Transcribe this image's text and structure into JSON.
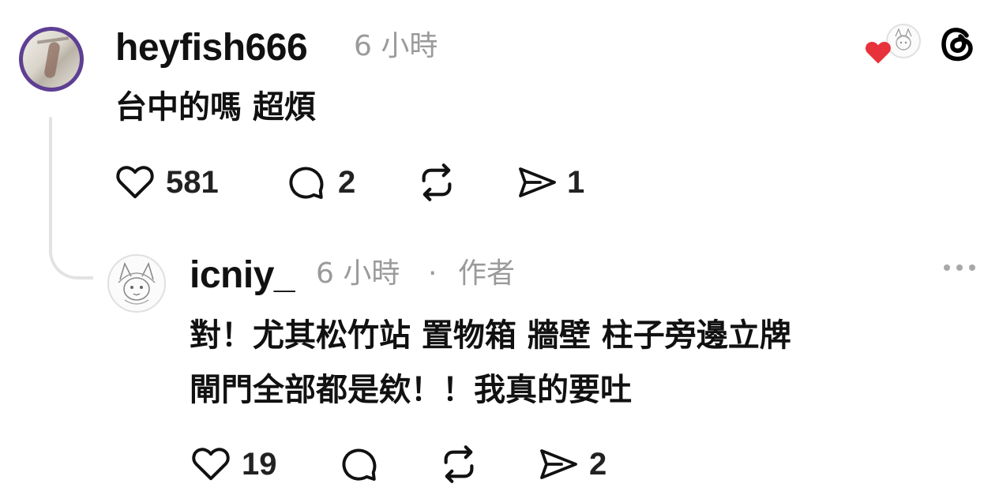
{
  "post": {
    "username": "heyfish666",
    "time": "6 小時",
    "text": "台中的嗎 超煩",
    "actions": {
      "like_count": "581",
      "comment_count": "2",
      "share_count": "1"
    }
  },
  "reply": {
    "username": "icniy_",
    "time": "6 小時",
    "separator": "·",
    "author_tag": "作者",
    "text_line1": "對！尤其松竹站 置物箱 牆壁 柱子旁邊立牌",
    "text_line2": "閘門全部都是欸！！我真的要吐",
    "actions": {
      "like_count": "19",
      "share_count": "2"
    }
  },
  "icons": {
    "like": "heart-outline-icon",
    "comment": "comment-bubble-icon",
    "repost": "repost-icon",
    "share": "send-icon",
    "liked_by_author": "red-heart-icon",
    "app_logo": "threads-logo-icon",
    "more": "more-options-icon"
  },
  "colors": {
    "liked_heart": "#e8323b",
    "secondary_text": "#9a9a9a",
    "primary_text": "#111111",
    "thread_line": "#e3e3e3"
  }
}
